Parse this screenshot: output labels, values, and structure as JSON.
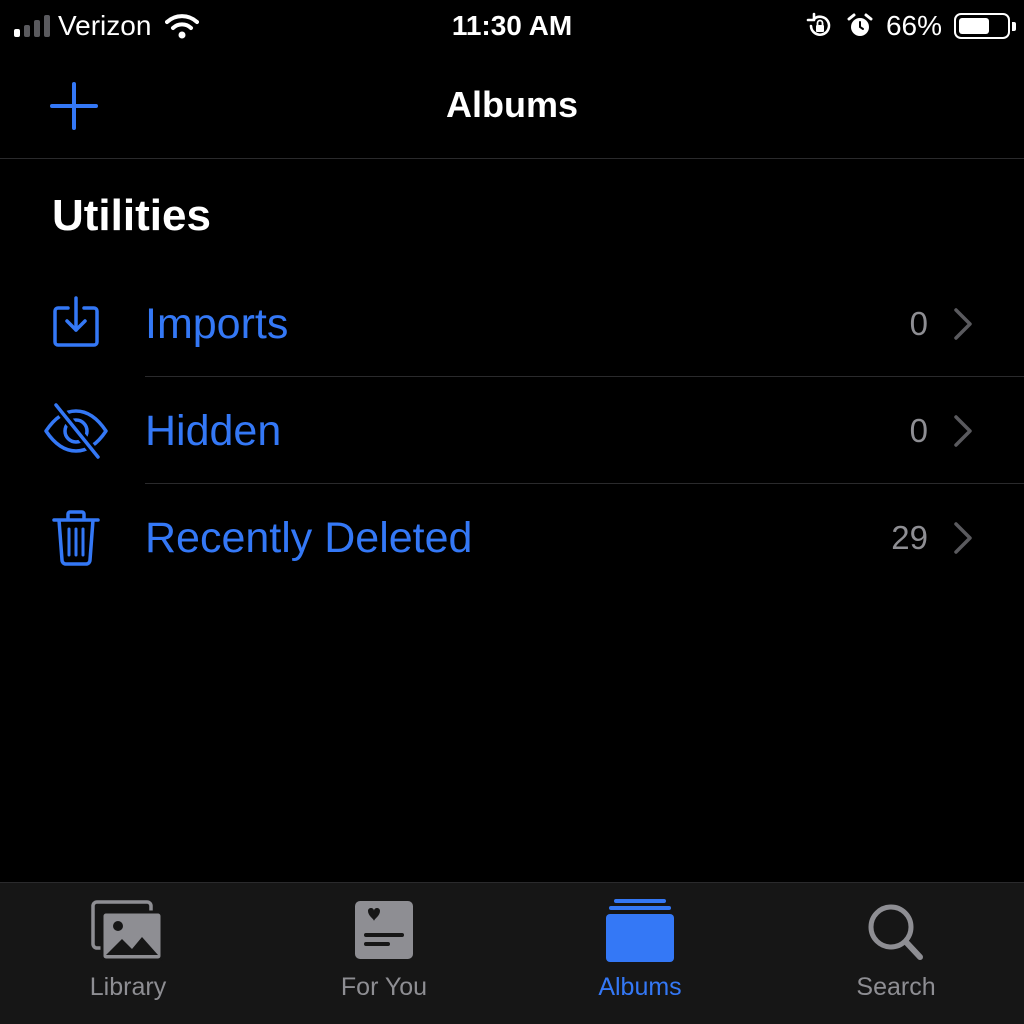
{
  "colors": {
    "accent": "#3478f6",
    "background": "#000000",
    "text": "#ffffff",
    "secondary_text": "#8e8e93",
    "tab_inactive": "#8e8e93",
    "tab_bar_bg": "#161616",
    "separator": "#2a2a2c"
  },
  "status_bar": {
    "carrier": "Verizon",
    "time": "11:30 AM",
    "battery_percent_label": "66%",
    "battery_level": 0.66,
    "signal_bars_active": 1,
    "signal_bars_total": 4,
    "icons": [
      "signal-icon",
      "wifi-icon",
      "rotation-lock-icon",
      "alarm-icon",
      "battery-icon"
    ]
  },
  "nav_bar": {
    "title": "Albums",
    "add_icon": "plus-icon"
  },
  "section": {
    "title": "Utilities"
  },
  "utilities": [
    {
      "label": "Imports",
      "count": "0",
      "icon": "import-icon"
    },
    {
      "label": "Hidden",
      "count": "0",
      "icon": "eye-slash-icon"
    },
    {
      "label": "Recently Deleted",
      "count": "29",
      "icon": "trash-icon"
    }
  ],
  "tab_bar": {
    "selected": "Albums",
    "tabs": [
      {
        "label": "Library",
        "icon": "photos-library-icon"
      },
      {
        "label": "For You",
        "icon": "for-you-icon"
      },
      {
        "label": "Albums",
        "icon": "albums-stack-icon"
      },
      {
        "label": "Search",
        "icon": "magnifier-icon"
      }
    ]
  }
}
